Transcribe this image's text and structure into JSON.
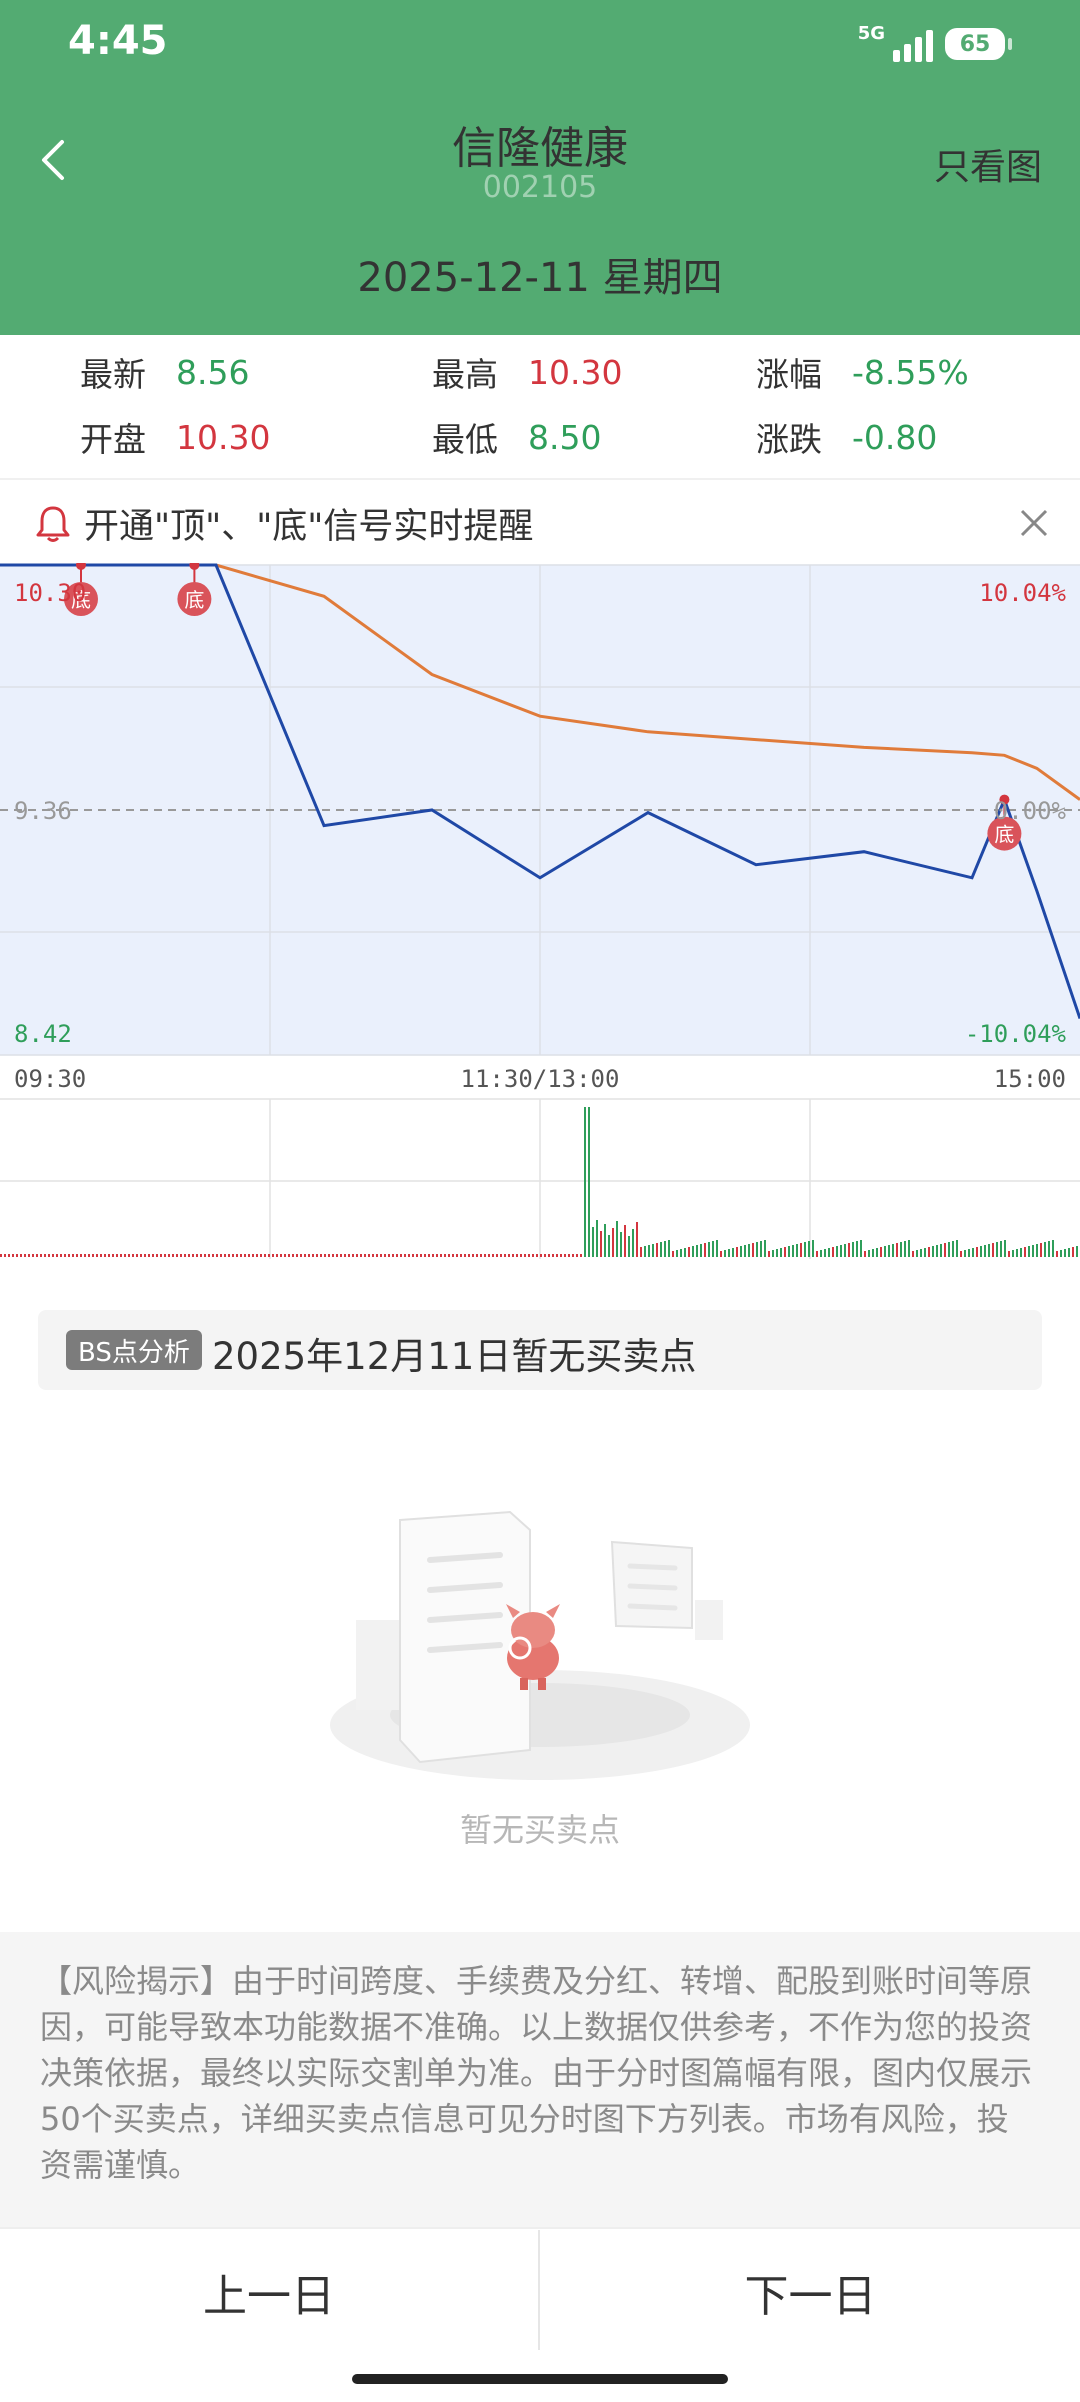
{
  "status": {
    "time": "4:45",
    "network": "5G",
    "battery": "65"
  },
  "header": {
    "title": "信隆健康",
    "code": "002105",
    "right_action": "只看图",
    "date": "2025-12-11 星期四"
  },
  "stats": [
    {
      "label": "最新",
      "value": "8.56",
      "color": "green"
    },
    {
      "label": "最高",
      "value": "10.30",
      "color": "red"
    },
    {
      "label": "涨幅",
      "value": "-8.55%",
      "color": "green"
    },
    {
      "label": "开盘",
      "value": "10.30",
      "color": "red"
    },
    {
      "label": "最低",
      "value": "8.50",
      "color": "green"
    },
    {
      "label": "涨跌",
      "value": "-0.80",
      "color": "green"
    }
  ],
  "alert": {
    "text": "开通\"顶\"、\"底\"信号实时提醒"
  },
  "chart_data": {
    "type": "line",
    "price_labels": {
      "top": "10.30",
      "mid": "9.36",
      "bottom": "8.42"
    },
    "pct_labels": {
      "top": "10.04%",
      "mid": "0.00%",
      "bottom": "-10.04%"
    },
    "x_ticks": [
      "09:30",
      "11:30/13:00",
      "15:00"
    ],
    "ylim": [
      8.42,
      10.3
    ],
    "session_fraction_x": [
      0.0,
      0.075,
      0.18,
      0.2,
      0.3,
      0.4,
      0.5,
      0.6,
      0.7,
      0.8,
      0.9,
      0.93,
      0.96,
      1.0
    ],
    "price_series": [
      10.3,
      10.3,
      10.3,
      10.3,
      9.3,
      9.36,
      9.1,
      9.35,
      9.15,
      9.2,
      9.1,
      9.4,
      9.05,
      8.56
    ],
    "avg_series": [
      10.3,
      10.3,
      10.3,
      10.3,
      10.18,
      9.88,
      9.72,
      9.66,
      9.63,
      9.6,
      9.58,
      9.57,
      9.52,
      9.4
    ],
    "markers": [
      {
        "label": "底",
        "x_fraction": 0.075
      },
      {
        "label": "底",
        "x_fraction": 0.18
      },
      {
        "label": "底",
        "x_fraction": 0.93
      }
    ]
  },
  "bs": {
    "tag": "BS点分析",
    "text": "2025年12月11日暂无买卖点",
    "empty_text": "暂无买卖点"
  },
  "risk": {
    "text": "【风险揭示】由于时间跨度、手续费及分红、转增、配股到账时间等原因，可能导致本功能数据不准确。以上数据仅供参考，不作为您的投资决策依据，最终以实际交割单为准。由于分时图篇幅有限，图内仅展示50个买卖点，详细买卖点信息可见分时图下方列表。市场有风险，投资需谨慎。"
  },
  "nav": {
    "prev": "上一日",
    "next": "下一日"
  },
  "colors": {
    "header": "#53ab72",
    "up": "#d3363f",
    "down": "#2f9e5a",
    "price_line": "#1f48a6",
    "avg_line": "#e07b3a"
  }
}
